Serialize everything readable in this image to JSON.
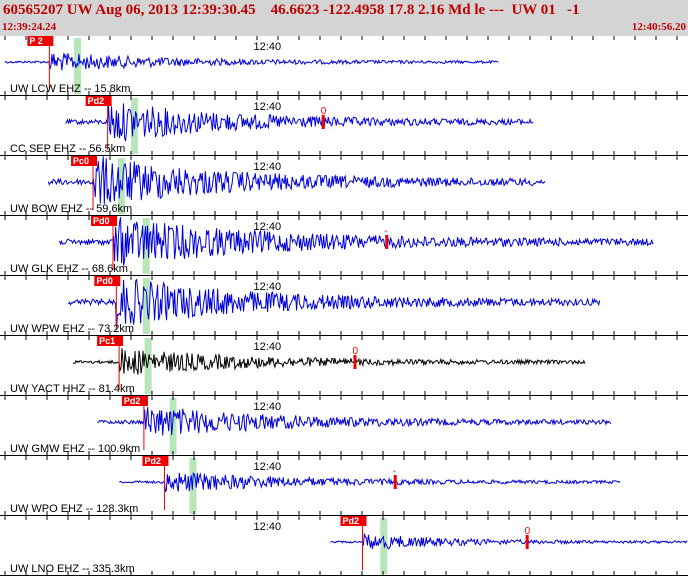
{
  "header": {
    "title": "60565207 UW Aug 06, 2013 12:39:30.45    46.6623 -122.4958 17.8 2.16 Md le ---  UW 01   -1",
    "start_time": "12:39:24.24",
    "end_time": "12:40:56.20"
  },
  "colors": {
    "header_bg": "#d4d4d4",
    "header_text": "#c00000",
    "trace_blue": "#0000dd",
    "trace_black": "#000000",
    "pick_red": "#ee0000",
    "window_green": "#b8e6b8"
  },
  "chart_data": {
    "type": "seismogram",
    "x_range": [
      "12:39:24.24",
      "12:40:56.20"
    ],
    "minute_mark": "12:40",
    "traces": [
      {
        "label": "UW LCW EHZ -- 15.8km",
        "pick": "P 2",
        "trace_color": "#0000dd",
        "amplitude": 0.35,
        "s_pick": "",
        "start": "12:39:24.9",
        "end": "12:40:30.9"
      },
      {
        "label": "CC SEP EHZ -- 56.5km",
        "pick": "Pd2",
        "trace_color": "#0000dd",
        "amplitude": 0.75,
        "s_pick": "0",
        "start": "12:39:33.0",
        "end": "12:40:35.5"
      },
      {
        "label": "UW BOW EHZ -- 59.6km",
        "pick": "Pc0",
        "trace_color": "#0000dd",
        "amplitude": 0.95,
        "s_pick": "",
        "start": "12:39:30.7",
        "end": "12:40:37.1"
      },
      {
        "label": "UW GLK EHZ -- 68.6km",
        "pick": "Pd0",
        "trace_color": "#0000dd",
        "amplitude": 0.9,
        "s_pick": "-",
        "start": "12:39:32.2",
        "end": "12:40:51.6"
      },
      {
        "label": "UW WPW EHZ -- 73.2km",
        "pick": "Pd0",
        "trace_color": "#0000dd",
        "amplitude": 0.9,
        "s_pick": "",
        "start": "12:39:33.4",
        "end": "12:40:44.4"
      },
      {
        "label": "UW YACT HHZ -- 81.4km",
        "pick": "Pc1",
        "trace_color": "#000000",
        "amplitude": 0.5,
        "s_pick": "0",
        "start": "12:39:34.0",
        "end": "12:40:42.4"
      },
      {
        "label": "UW GMW EHZ -- 100.9km",
        "pick": "Pd2",
        "trace_color": "#0000dd",
        "amplitude": 0.6,
        "s_pick": "",
        "start": "12:39:37.3",
        "end": "12:40:45.9"
      },
      {
        "label": "UW WPO EHZ -- 128.3km",
        "pick": "Pd2",
        "trace_color": "#0000dd",
        "amplitude": 0.4,
        "s_pick": "-",
        "start": "12:39:40.2",
        "end": "12:40:47.1"
      },
      {
        "label": "UW LNO EHZ -- 335.3km",
        "pick": "Pd2",
        "trace_color": "#0000dd",
        "amplitude": 0.3,
        "s_pick": "0",
        "start": "12:40:08.4",
        "end": "12:40:56.1"
      }
    ]
  }
}
